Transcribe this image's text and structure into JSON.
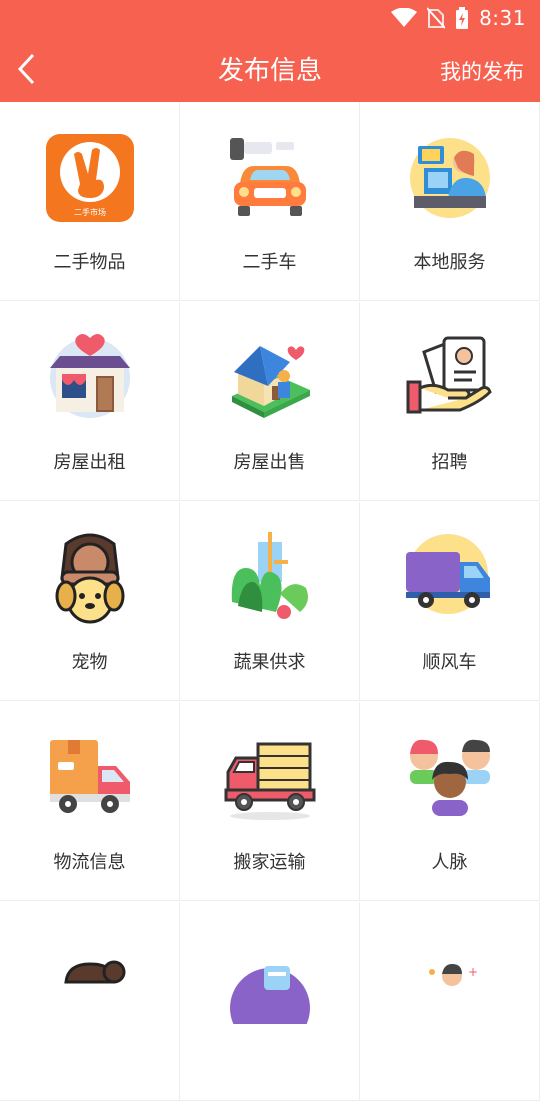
{
  "status": {
    "time": "8:31"
  },
  "header": {
    "title": "发布信息",
    "right_action": "我的发布"
  },
  "categories": [
    {
      "label": "二手物品",
      "icon": "second-hand-market-icon"
    },
    {
      "label": "二手车",
      "icon": "used-car-icon"
    },
    {
      "label": "本地服务",
      "icon": "local-service-icon"
    },
    {
      "label": "房屋出租",
      "icon": "house-rent-icon"
    },
    {
      "label": "房屋出售",
      "icon": "house-sale-icon"
    },
    {
      "label": "招聘",
      "icon": "recruitment-icon"
    },
    {
      "label": "宠物",
      "icon": "pet-icon"
    },
    {
      "label": "蔬果供求",
      "icon": "produce-icon"
    },
    {
      "label": "顺风车",
      "icon": "carpool-truck-icon"
    },
    {
      "label": "物流信息",
      "icon": "logistics-icon"
    },
    {
      "label": "搬家运输",
      "icon": "moving-truck-icon"
    },
    {
      "label": "人脉",
      "icon": "network-people-icon"
    }
  ],
  "logo_text": "二手市场"
}
